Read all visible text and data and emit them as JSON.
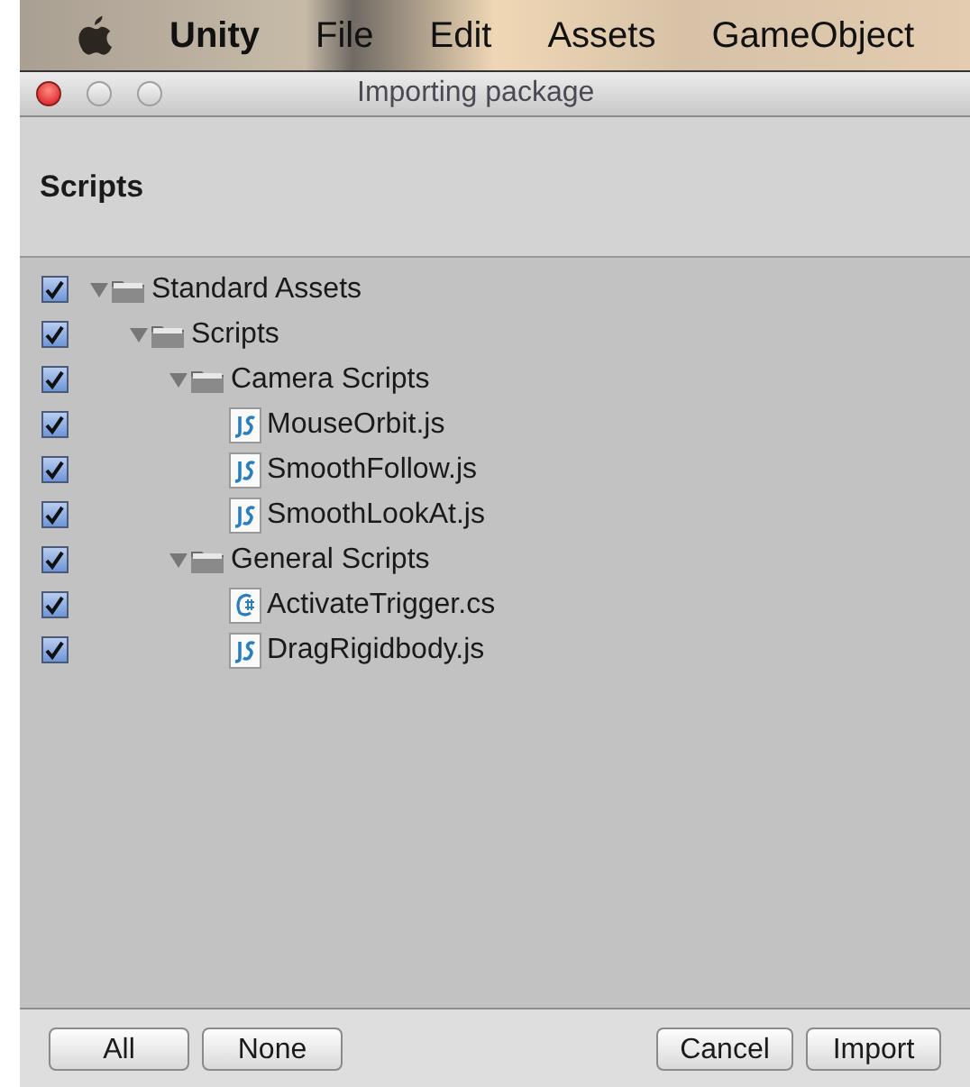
{
  "menu_bar": {
    "items": [
      {
        "label": "Unity",
        "bold": true
      },
      {
        "label": "File",
        "bold": false
      },
      {
        "label": "Edit",
        "bold": false
      },
      {
        "label": "Assets",
        "bold": false
      },
      {
        "label": "GameObject",
        "bold": false
      }
    ]
  },
  "window": {
    "title": "Importing package"
  },
  "header": {
    "title": "Scripts"
  },
  "tree": [
    {
      "label": "Standard Assets",
      "kind": "folder",
      "checked": true,
      "expanded": true,
      "children": [
        {
          "label": "Scripts",
          "kind": "folder",
          "checked": true,
          "expanded": true,
          "children": [
            {
              "label": "Camera Scripts",
              "kind": "folder",
              "checked": true,
              "expanded": true,
              "children": [
                {
                  "label": "MouseOrbit.js",
                  "kind": "js",
                  "checked": true
                },
                {
                  "label": "SmoothFollow.js",
                  "kind": "js",
                  "checked": true
                },
                {
                  "label": "SmoothLookAt.js",
                  "kind": "js",
                  "checked": true
                }
              ]
            },
            {
              "label": "General Scripts",
              "kind": "folder",
              "checked": true,
              "expanded": true,
              "children": [
                {
                  "label": "ActivateTrigger.cs",
                  "kind": "cs",
                  "checked": true
                },
                {
                  "label": "DragRigidbody.js",
                  "kind": "js",
                  "checked": true
                }
              ]
            }
          ]
        }
      ]
    }
  ],
  "buttons_left": [
    "All",
    "None"
  ],
  "buttons_right": [
    "Cancel",
    "Import"
  ]
}
